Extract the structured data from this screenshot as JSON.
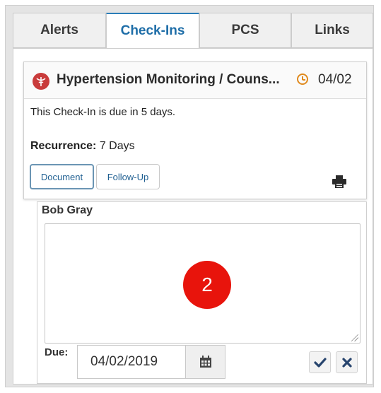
{
  "tabs": [
    {
      "label": "Alerts",
      "active": false
    },
    {
      "label": "Check-Ins",
      "active": true
    },
    {
      "label": "PCS",
      "active": false
    },
    {
      "label": "Links",
      "active": false
    }
  ],
  "card": {
    "icon": "caduceus-icon",
    "title": "Hypertension Monitoring / Couns...",
    "date": "04/02",
    "due_message": "This Check-In is due in 5 days.",
    "recurrence_label": "Recurrence:",
    "recurrence_value": "7 Days",
    "document_button": "Document",
    "followup_button": "Follow-Up",
    "print_icon": "printer-icon"
  },
  "note": {
    "author": "Bob Gray",
    "text": "",
    "step_badge": "2",
    "due_label": "Due:",
    "due_value": "04/02/2019",
    "calendar_icon": "calendar-icon",
    "confirm_icon": "check-icon",
    "cancel_icon": "close-icon"
  },
  "colors": {
    "accent": "#1f6ea8",
    "badge": "#e8140c",
    "clock": "#e08a1e",
    "action_icon": "#28456e"
  }
}
